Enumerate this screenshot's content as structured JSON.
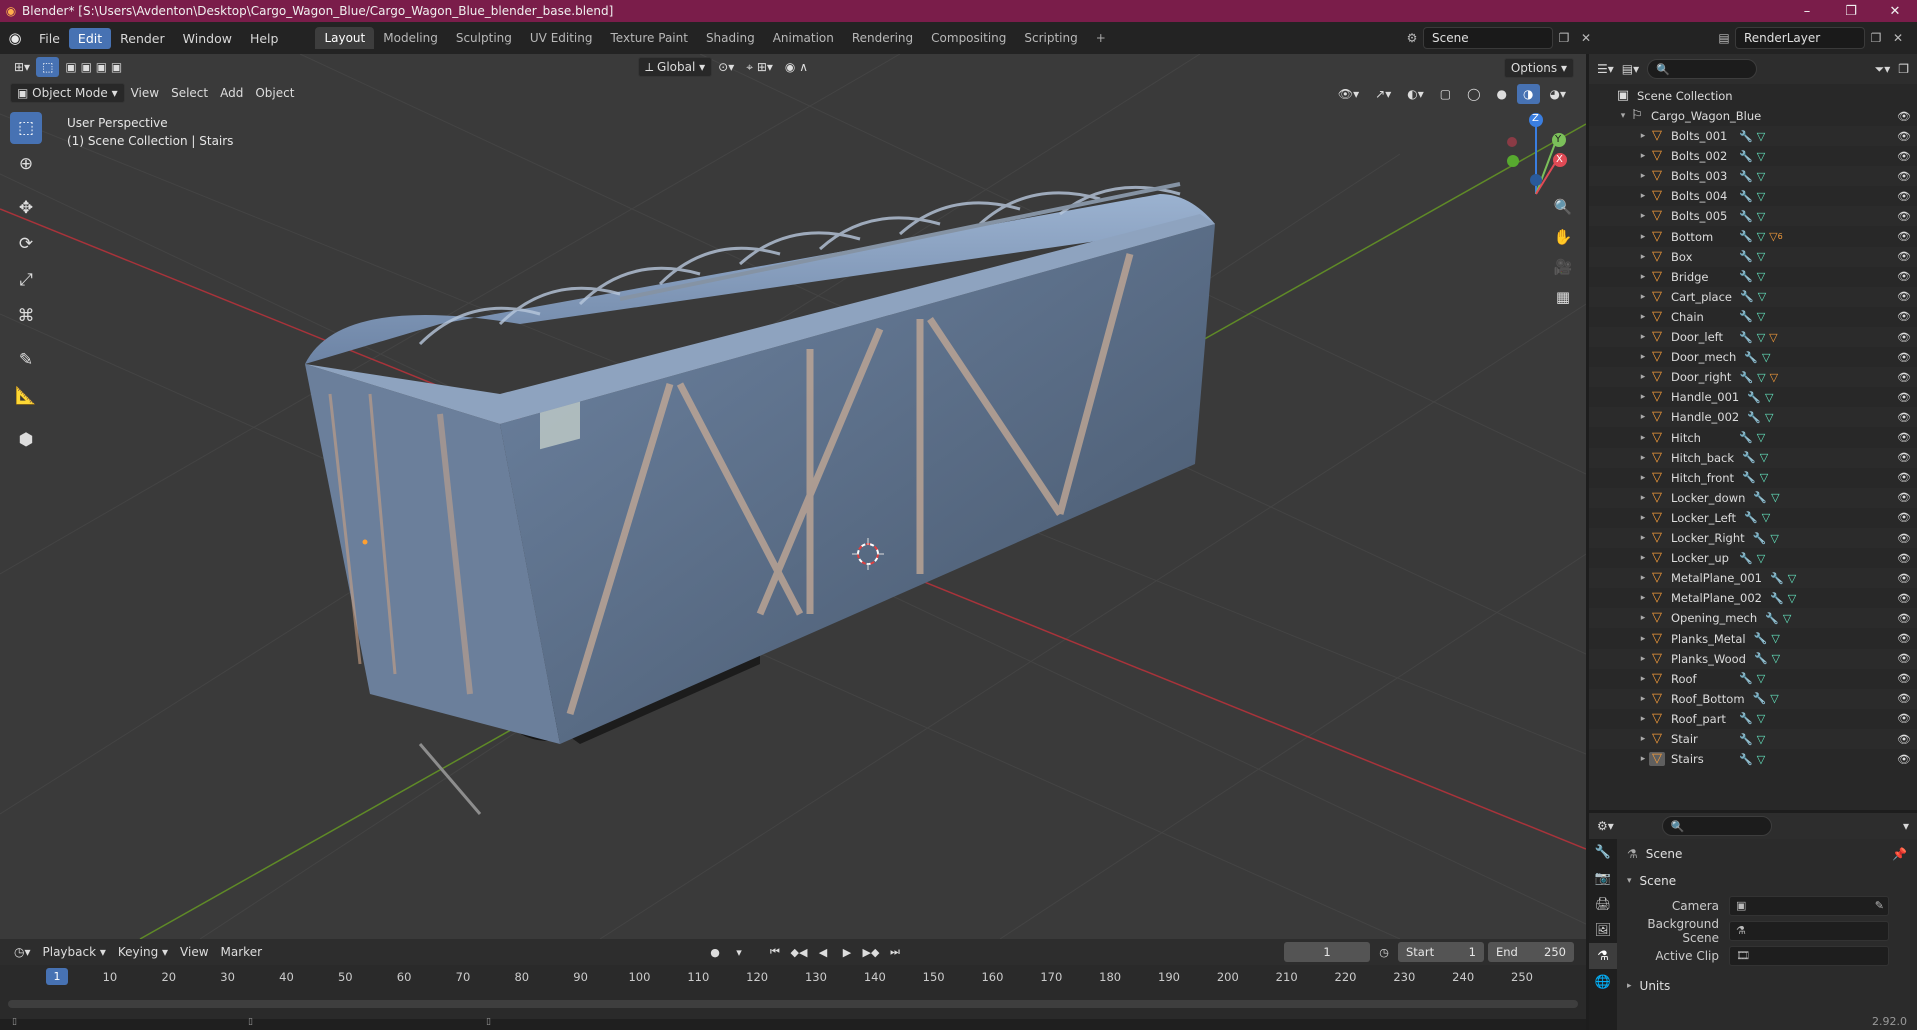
{
  "window": {
    "title": "Blender* [S:\\Users\\Avdenton\\Desktop\\Cargo_Wagon_Blue/Cargo_Wagon_Blue_blender_base.blend]",
    "controls": [
      "minimize-icon",
      "maximize-icon",
      "close-icon"
    ]
  },
  "menu": [
    "File",
    "Edit",
    "Render",
    "Window",
    "Help"
  ],
  "active_menu": "Edit",
  "workspace_tabs": [
    "Layout",
    "Modeling",
    "Sculpting",
    "UV Editing",
    "Texture Paint",
    "Shading",
    "Animation",
    "Rendering",
    "Compositing",
    "Scripting",
    "+"
  ],
  "active_tab": "Layout",
  "scene_name": "Scene",
  "render_layer": "RenderLayer",
  "viewport": {
    "transform_orientation": "Global",
    "mode": "Object Mode",
    "header_menus": [
      "View",
      "Select",
      "Add",
      "Object"
    ],
    "options_label": "Options",
    "perspective": "User Perspective",
    "collection_info": "(1) Scene Collection | Stairs",
    "gizmo_axes": [
      "Z",
      "Y",
      "X"
    ]
  },
  "outliner": {
    "root": "Scene Collection",
    "collection": "Cargo_Wagon_Blue",
    "objects": [
      {
        "name": "Bolts_001",
        "mat": false
      },
      {
        "name": "Bolts_002",
        "mat": false
      },
      {
        "name": "Bolts_003",
        "mat": false
      },
      {
        "name": "Bolts_004",
        "mat": false
      },
      {
        "name": "Bolts_005",
        "mat": false
      },
      {
        "name": "Bottom",
        "mat": true,
        "mat_count": "6"
      },
      {
        "name": "Box",
        "mat": false
      },
      {
        "name": "Bridge",
        "mat": false
      },
      {
        "name": "Cart_place",
        "mat": false
      },
      {
        "name": "Chain",
        "mat": false
      },
      {
        "name": "Door_left",
        "mat": true
      },
      {
        "name": "Door_mech",
        "mat": false
      },
      {
        "name": "Door_right",
        "mat": true
      },
      {
        "name": "Handle_001",
        "mat": false
      },
      {
        "name": "Handle_002",
        "mat": false
      },
      {
        "name": "Hitch",
        "mat": false
      },
      {
        "name": "Hitch_back",
        "mat": false
      },
      {
        "name": "Hitch_front",
        "mat": false
      },
      {
        "name": "Locker_down",
        "mat": false
      },
      {
        "name": "Locker_Left",
        "mat": false
      },
      {
        "name": "Locker_Right",
        "mat": false
      },
      {
        "name": "Locker_up",
        "mat": false
      },
      {
        "name": "MetalPlane_001",
        "mat": false
      },
      {
        "name": "MetalPlane_002",
        "mat": false
      },
      {
        "name": "Opening_mech",
        "mat": false
      },
      {
        "name": "Planks_Metal",
        "mat": false
      },
      {
        "name": "Planks_Wood",
        "mat": false
      },
      {
        "name": "Roof",
        "mat": false
      },
      {
        "name": "Roof_Bottom",
        "mat": false
      },
      {
        "name": "Roof_part",
        "mat": false
      },
      {
        "name": "Stair",
        "mat": false
      },
      {
        "name": "Stairs",
        "mat": false,
        "selected": true
      }
    ]
  },
  "properties": {
    "context": "Scene",
    "section": "Scene",
    "fields": [
      {
        "label": "Camera",
        "value": ""
      },
      {
        "label": "Background Scene",
        "value": ""
      },
      {
        "label": "Active Clip",
        "value": ""
      }
    ],
    "collapsed_section": "Units",
    "version": "2.92.0"
  },
  "timeline": {
    "menus": [
      "Playback",
      "Keying",
      "View",
      "Marker"
    ],
    "current_frame": "1",
    "start_label": "Start",
    "start": "1",
    "end_label": "End",
    "end": "250",
    "ticks": [
      "1",
      "10",
      "20",
      "30",
      "40",
      "50",
      "60",
      "70",
      "80",
      "90",
      "100",
      "110",
      "120",
      "130",
      "140",
      "150",
      "160",
      "170",
      "180",
      "190",
      "200",
      "210",
      "220",
      "230",
      "240",
      "250"
    ]
  },
  "colors": {
    "title_bar": "#7a1d4a",
    "accent": "#4772b3",
    "object_icon": "#f29a3a",
    "mesh_icon": "#65e6c0",
    "x_axis": "#c4333a",
    "y_axis": "#6f9a2c",
    "wagon_body": "#5c6f88"
  }
}
